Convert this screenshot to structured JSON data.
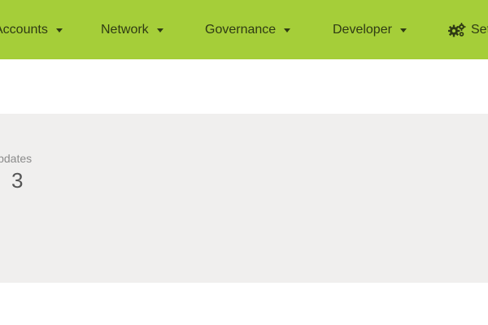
{
  "nav": {
    "items": [
      {
        "label": "Accounts"
      },
      {
        "label": "Network"
      },
      {
        "label": "Governance"
      },
      {
        "label": "Developer"
      },
      {
        "label": "Settings"
      }
    ],
    "settings_icon": "gears-icon",
    "dropdown_icon": "caret-down-icon"
  },
  "stats": {
    "label": "Updates",
    "value": "3"
  },
  "colors": {
    "nav_background": "#a5ce39",
    "nav_text": "#2f3b14",
    "panel_background": "#f0efee",
    "page_background": "#ffffff"
  }
}
